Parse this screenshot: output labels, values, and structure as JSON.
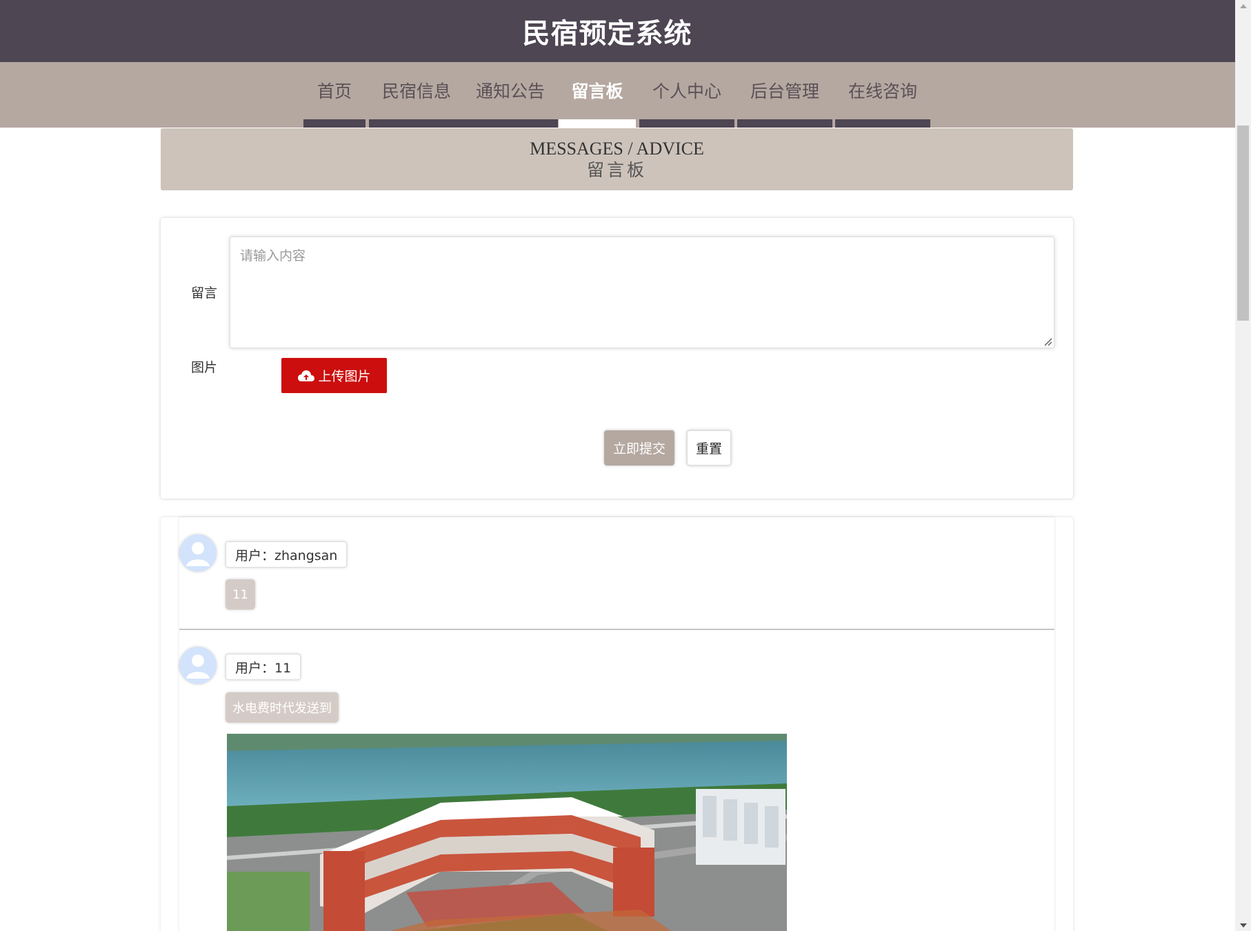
{
  "header": {
    "title": "民宿预定系统"
  },
  "nav": {
    "items": [
      {
        "label": "首页"
      },
      {
        "label": "民宿信息"
      },
      {
        "label": "通知公告"
      },
      {
        "label": "留言板"
      },
      {
        "label": "个人中心"
      },
      {
        "label": "后台管理"
      },
      {
        "label": "在线咨询"
      }
    ],
    "active_index": 3
  },
  "banner": {
    "title_en": "MESSAGES / ADVICE",
    "title_zh": "留言板"
  },
  "form": {
    "message_label": "留言",
    "message_placeholder": "请输入内容",
    "image_label": "图片",
    "upload_label": "上传图片",
    "submit_label": "立即提交",
    "reset_label": "重置"
  },
  "messages": [
    {
      "user": "用户：zhangsan",
      "content": "11",
      "has_image": false
    },
    {
      "user": "用户：11",
      "content": "水电费时代发送到",
      "has_image": true
    }
  ],
  "colors": {
    "header_bg": "#4e4653",
    "nav_bg": "#b5a8a1",
    "banner_bg": "#cdc3bb",
    "upload_btn": "#cc0e0e",
    "submit_btn": "#b5a8a1"
  }
}
